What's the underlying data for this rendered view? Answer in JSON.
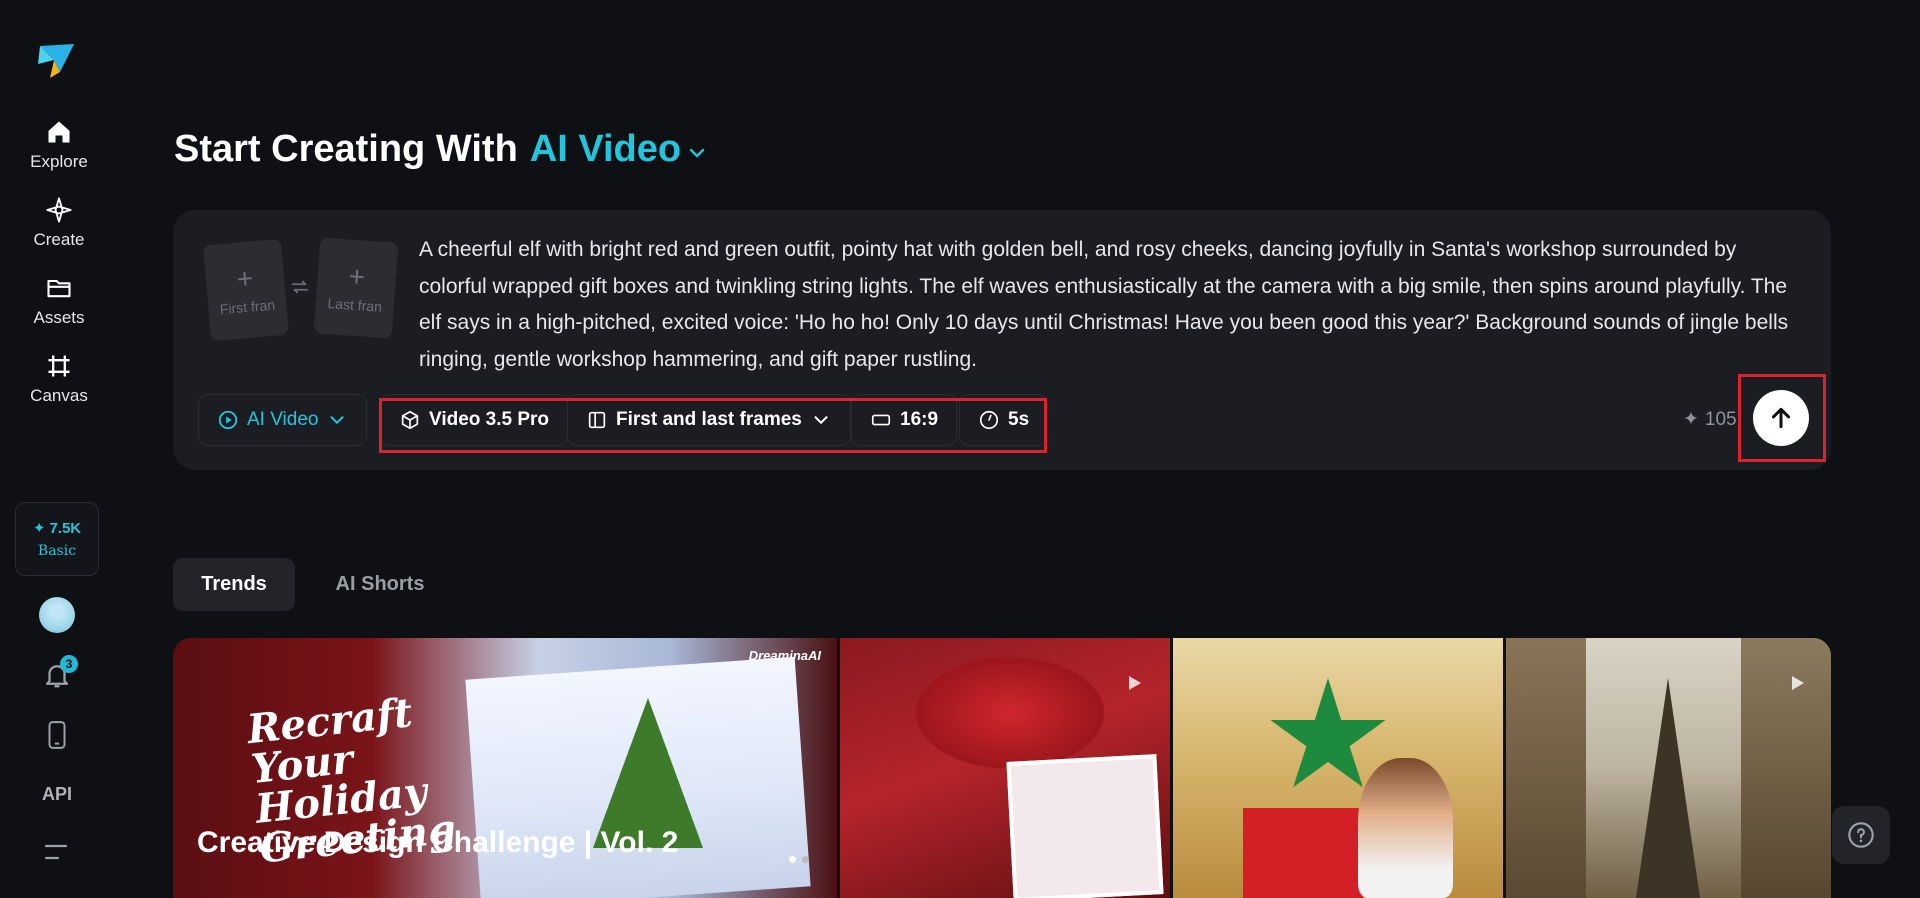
{
  "sidebar": {
    "items": [
      {
        "label": "Explore",
        "icon": "home-icon"
      },
      {
        "label": "Create",
        "icon": "sparkle-icon"
      },
      {
        "label": "Assets",
        "icon": "folder-icon"
      },
      {
        "label": "Canvas",
        "icon": "canvas-icon"
      }
    ],
    "credits": {
      "value": "7.5K",
      "plan": "Basic"
    },
    "notifications_count": "3",
    "api_label": "API"
  },
  "header": {
    "title_prefix": "Start Creating With",
    "title_accent": "AI Video"
  },
  "prompt": {
    "first_frame_label": "First fran",
    "last_frame_label": "Last fran",
    "text": " A cheerful elf with bright red and green outfit, pointy hat with golden bell, and rosy cheeks, dancing joyfully in Santa's workshop surrounded by colorful wrapped gift boxes and twinkling string lights. The elf waves enthusiastically at the camera with a big smile, then spins around playfully. The elf says in a high-pitched, excited voice: 'Ho ho ho! Only 10 days until Christmas! Have you been good this year?' Background sounds of jingle bells ringing, gentle workshop hammering, and gift paper rustling.",
    "mode": "AI Video",
    "model": "Video 3.5 Pro",
    "frames_option": "First and last frames",
    "aspect_ratio": "16:9",
    "duration": "5s",
    "cost": "105"
  },
  "tabs": [
    {
      "label": "Trends",
      "active": true
    },
    {
      "label": "AI Shorts",
      "active": false
    }
  ],
  "gallery": {
    "featured": {
      "script_text": "Recraft Your Holiday Greeting",
      "brand": "DreaminaAI",
      "headline": "Creative Design Challenge | Vol. 2"
    }
  },
  "colors": {
    "accent": "#22c5dc",
    "highlight": "#d9232e",
    "background": "#0f1014",
    "card": "#1c1d22"
  }
}
